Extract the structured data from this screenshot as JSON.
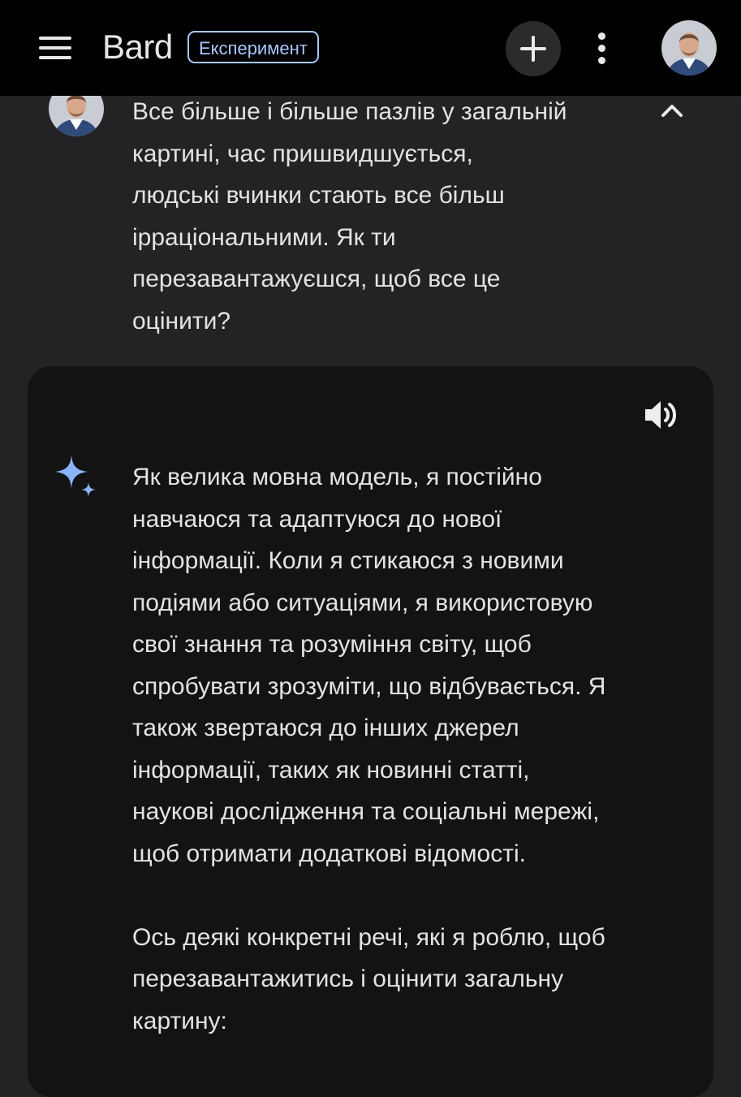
{
  "header": {
    "brand": "Bard",
    "badge": "Експеримент",
    "icons": {
      "menu": "hamburger-menu-icon",
      "new_chat": "plus-icon",
      "more": "more-vertical-icon",
      "profile": "user-avatar"
    }
  },
  "conversation": {
    "prompt": {
      "text": "Все більше і більше пазлів у загальній\nкартині, час пришвидшується,\nлюдські вчинки стають все більш\nірраціональними. Як ти\nперезавантажуєшся, щоб все це\nоцінити?",
      "icons": {
        "avatar": "user-avatar",
        "collapse": "chevron-up-icon"
      }
    },
    "response": {
      "paragraphs": [
        "Як велика мовна модель, я постійно\nнавчаюся та адаптуюся до нової\nінформації. Коли я стикаюся з новими\nподіями або ситуаціями, я використовую\nсвої знання та розуміння світу, щоб\nспробувати зрозуміти, що відбувається. Я\nтакож звертаюся до інших джерел\nінформації, таких як новинні статті,\nнаукові дослідження та соціальні мережі,\nщоб отримати додаткові відомості.",
        "Ось деякі конкретні речі, які я роблю, щоб\nперезавантажитись і оцінити загальну\nкартину:"
      ],
      "icons": {
        "speaker": "speaker-icon",
        "bard": "bard-sparkle-icon"
      }
    }
  },
  "colors": {
    "topbar": "#000000",
    "page_background": "#232326",
    "card_background": "#131314",
    "text": "#e3e3e3",
    "badge_accent": "#a8c7fa",
    "sparkle_accent": "#8ab4f8"
  }
}
